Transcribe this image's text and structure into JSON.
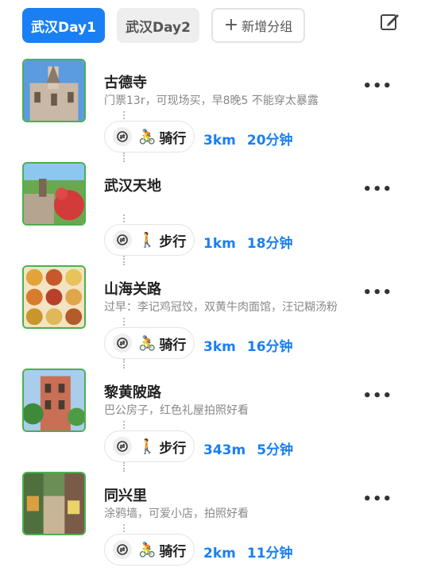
{
  "tabs": {
    "day1": "武汉Day1",
    "day2": "武汉Day2",
    "add": "新增分组"
  },
  "items": [
    {
      "title": "古德寺",
      "desc": "门票13r，可现场买，早8晚5 不能穿太暴露",
      "mode": "骑行",
      "mode_icon": "bike-icon",
      "distance": "3km",
      "duration": "20分钟"
    },
    {
      "title": "武汉天地",
      "desc": "",
      "mode": "步行",
      "mode_icon": "walk-icon",
      "distance": "1km",
      "duration": "18分钟"
    },
    {
      "title": "山海关路",
      "desc": "过早：李记鸡冠饺，双黄牛肉面馆，汪记糊汤粉",
      "mode": "骑行",
      "mode_icon": "bike-icon",
      "distance": "3km",
      "duration": "16分钟"
    },
    {
      "title": "黎黄陂路",
      "desc": "巴公房子，红色礼屋拍照好看",
      "mode": "步行",
      "mode_icon": "walk-icon",
      "distance": "343m",
      "duration": "5分钟"
    },
    {
      "title": "同兴里",
      "desc": "涂鸦墙，可爱小店，拍照好看",
      "mode": "骑行",
      "mode_icon": "bike-icon",
      "distance": "2km",
      "duration": "11分钟"
    }
  ],
  "more_label": "•••",
  "colors": {
    "accent": "#1a7ff2",
    "thumb_border": "#4caf50"
  }
}
